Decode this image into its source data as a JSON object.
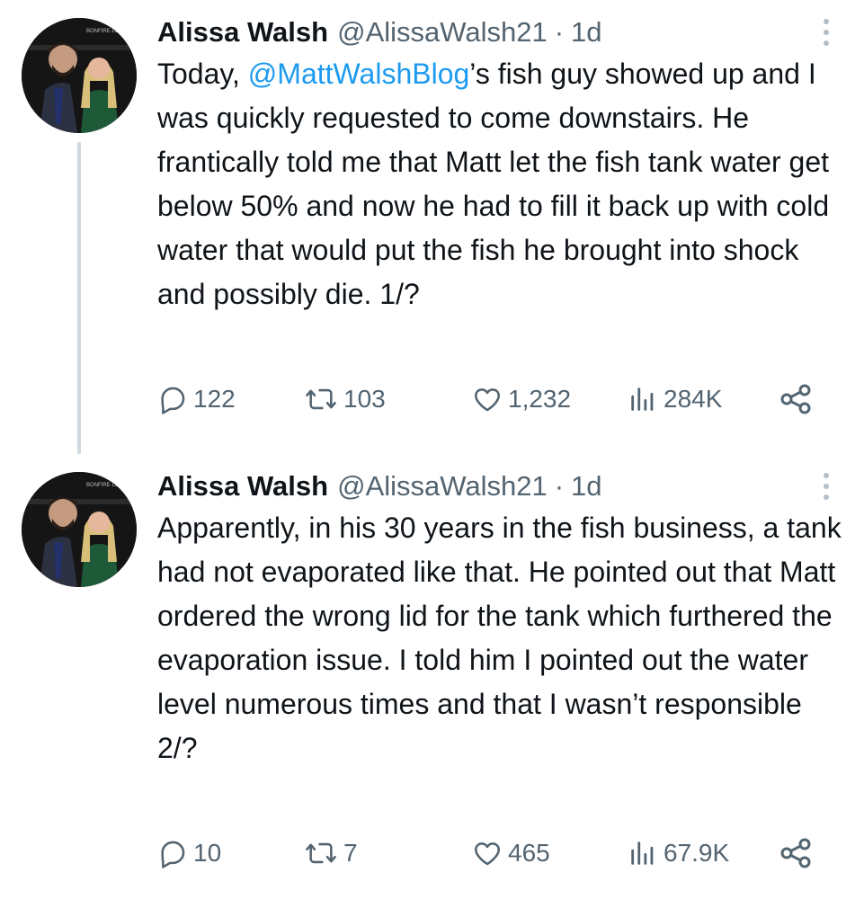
{
  "tweets": [
    {
      "author_name": "Alissa Walsh",
      "author_handle": "@AlissaWalsh21",
      "separator": "·",
      "time": "1d",
      "text_before_mention": "Today, ",
      "mention": "@MattWalshBlog",
      "text_after_mention": "’s fish guy showed up and I was quickly requested to come downstairs. He frantically told me that Matt let the fish tank water get below 50% and now he had to fill it back up with cold water that would put the fish he brought into shock and possibly die. 1/?",
      "replies": "122",
      "retweets": "103",
      "likes": "1,232",
      "views": "284K"
    },
    {
      "author_name": "Alissa Walsh",
      "author_handle": "@AlissaWalsh21",
      "separator": "·",
      "time": "1d",
      "text": "Apparently, in his 30 years in the fish business, a tank had not evaporated like that. He pointed out that Matt ordered the wrong lid for the tank which furthered the evaporation issue. I told him I pointed out the water level numerous times and that I wasn’t responsible 2/?",
      "replies": "10",
      "retweets": "7",
      "likes": "465",
      "views": "67.9K"
    }
  ],
  "colors": {
    "text": "#0f1419",
    "secondary": "#536471",
    "link": "#1d9bf0",
    "thread_line": "#cfd9de"
  },
  "icons": [
    "reply-icon",
    "retweet-icon",
    "like-icon",
    "views-icon",
    "share-icon",
    "more-icon"
  ]
}
